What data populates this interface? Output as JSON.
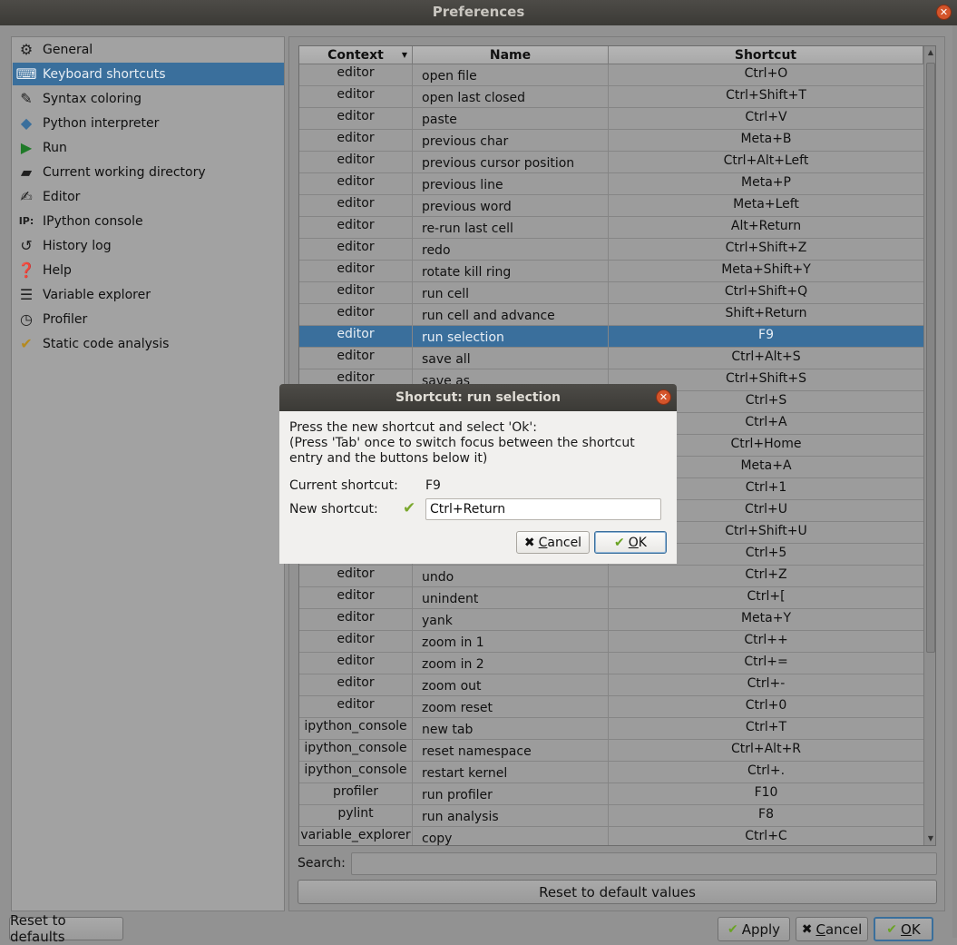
{
  "window": {
    "title": "Preferences"
  },
  "sidebar": {
    "items": [
      {
        "label": "General",
        "icon": "gears-icon"
      },
      {
        "label": "Keyboard shortcuts",
        "icon": "keyboard-icon",
        "active": true
      },
      {
        "label": "Syntax coloring",
        "icon": "eyedropper-icon"
      },
      {
        "label": "Python interpreter",
        "icon": "python-icon"
      },
      {
        "label": "Run",
        "icon": "play-icon"
      },
      {
        "label": "Current working directory",
        "icon": "folder-open-icon"
      },
      {
        "label": "Editor",
        "icon": "edit-icon"
      },
      {
        "label": "IPython console",
        "icon": "ipython-icon"
      },
      {
        "label": "History log",
        "icon": "history-icon"
      },
      {
        "label": "Help",
        "icon": "help-icon"
      },
      {
        "label": "Variable explorer",
        "icon": "table-list-icon"
      },
      {
        "label": "Profiler",
        "icon": "clock-icon"
      },
      {
        "label": "Static code analysis",
        "icon": "pylint-icon"
      }
    ]
  },
  "table": {
    "headers": {
      "context": "Context",
      "name": "Name",
      "shortcut": "Shortcut"
    },
    "rows": [
      {
        "context": "editor",
        "name": "open file",
        "shortcut": "Ctrl+O"
      },
      {
        "context": "editor",
        "name": "open last closed",
        "shortcut": "Ctrl+Shift+T"
      },
      {
        "context": "editor",
        "name": "paste",
        "shortcut": "Ctrl+V"
      },
      {
        "context": "editor",
        "name": "previous char",
        "shortcut": "Meta+B"
      },
      {
        "context": "editor",
        "name": "previous cursor position",
        "shortcut": "Ctrl+Alt+Left"
      },
      {
        "context": "editor",
        "name": "previous line",
        "shortcut": "Meta+P"
      },
      {
        "context": "editor",
        "name": "previous word",
        "shortcut": "Meta+Left"
      },
      {
        "context": "editor",
        "name": "re-run last cell",
        "shortcut": "Alt+Return"
      },
      {
        "context": "editor",
        "name": "redo",
        "shortcut": "Ctrl+Shift+Z"
      },
      {
        "context": "editor",
        "name": "rotate kill ring",
        "shortcut": "Meta+Shift+Y"
      },
      {
        "context": "editor",
        "name": "run cell",
        "shortcut": "Ctrl+Shift+Q"
      },
      {
        "context": "editor",
        "name": "run cell and advance",
        "shortcut": "Shift+Return"
      },
      {
        "context": "editor",
        "name": "run selection",
        "shortcut": "F9",
        "selected": true
      },
      {
        "context": "editor",
        "name": "save all",
        "shortcut": "Ctrl+Alt+S"
      },
      {
        "context": "editor",
        "name": "save as",
        "shortcut": "Ctrl+Shift+S"
      },
      {
        "context": "",
        "name": "",
        "shortcut": "Ctrl+S"
      },
      {
        "context": "",
        "name": "",
        "shortcut": "Ctrl+A"
      },
      {
        "context": "",
        "name": "",
        "shortcut": "Ctrl+Home"
      },
      {
        "context": "",
        "name": "",
        "shortcut": "Meta+A"
      },
      {
        "context": "",
        "name": "",
        "shortcut": "Ctrl+1"
      },
      {
        "context": "",
        "name": "",
        "shortcut": "Ctrl+U"
      },
      {
        "context": "",
        "name": "",
        "shortcut": "Ctrl+Shift+U"
      },
      {
        "context": "",
        "name": "",
        "shortcut": "Ctrl+5"
      },
      {
        "context": "editor",
        "name": "undo",
        "shortcut": "Ctrl+Z"
      },
      {
        "context": "editor",
        "name": "unindent",
        "shortcut": "Ctrl+["
      },
      {
        "context": "editor",
        "name": "yank",
        "shortcut": "Meta+Y"
      },
      {
        "context": "editor",
        "name": "zoom in 1",
        "shortcut": "Ctrl++"
      },
      {
        "context": "editor",
        "name": "zoom in 2",
        "shortcut": "Ctrl+="
      },
      {
        "context": "editor",
        "name": "zoom out",
        "shortcut": "Ctrl+-"
      },
      {
        "context": "editor",
        "name": "zoom reset",
        "shortcut": "Ctrl+0"
      },
      {
        "context": "ipython_console",
        "name": "new tab",
        "shortcut": "Ctrl+T"
      },
      {
        "context": "ipython_console",
        "name": "reset namespace",
        "shortcut": "Ctrl+Alt+R"
      },
      {
        "context": "ipython_console",
        "name": "restart kernel",
        "shortcut": "Ctrl+."
      },
      {
        "context": "profiler",
        "name": "run profiler",
        "shortcut": "F10"
      },
      {
        "context": "pylint",
        "name": "run analysis",
        "shortcut": "F8"
      },
      {
        "context": "variable_explorer",
        "name": "copy",
        "shortcut": "Ctrl+C"
      }
    ]
  },
  "search": {
    "label": "Search:",
    "value": ""
  },
  "buttons": {
    "reset_default_values": "Reset to default values",
    "reset_to_defaults": "Reset to defaults",
    "apply": "Apply",
    "cancel_u": "C",
    "cancel_rest": "ancel",
    "ok_u": "O",
    "ok_rest": "K"
  },
  "dialog": {
    "title": "Shortcut: run selection",
    "instructions_1": "Press the new shortcut and select 'Ok':",
    "instructions_2": "(Press 'Tab' once to switch focus between the shortcut entry and the buttons below it)",
    "current_label": "Current shortcut:",
    "current_value": "F9",
    "new_label": "New shortcut:",
    "new_value": "Ctrl+Return",
    "cancel_u": "C",
    "cancel_rest": "ancel",
    "ok_u": "O",
    "ok_rest": "K"
  }
}
